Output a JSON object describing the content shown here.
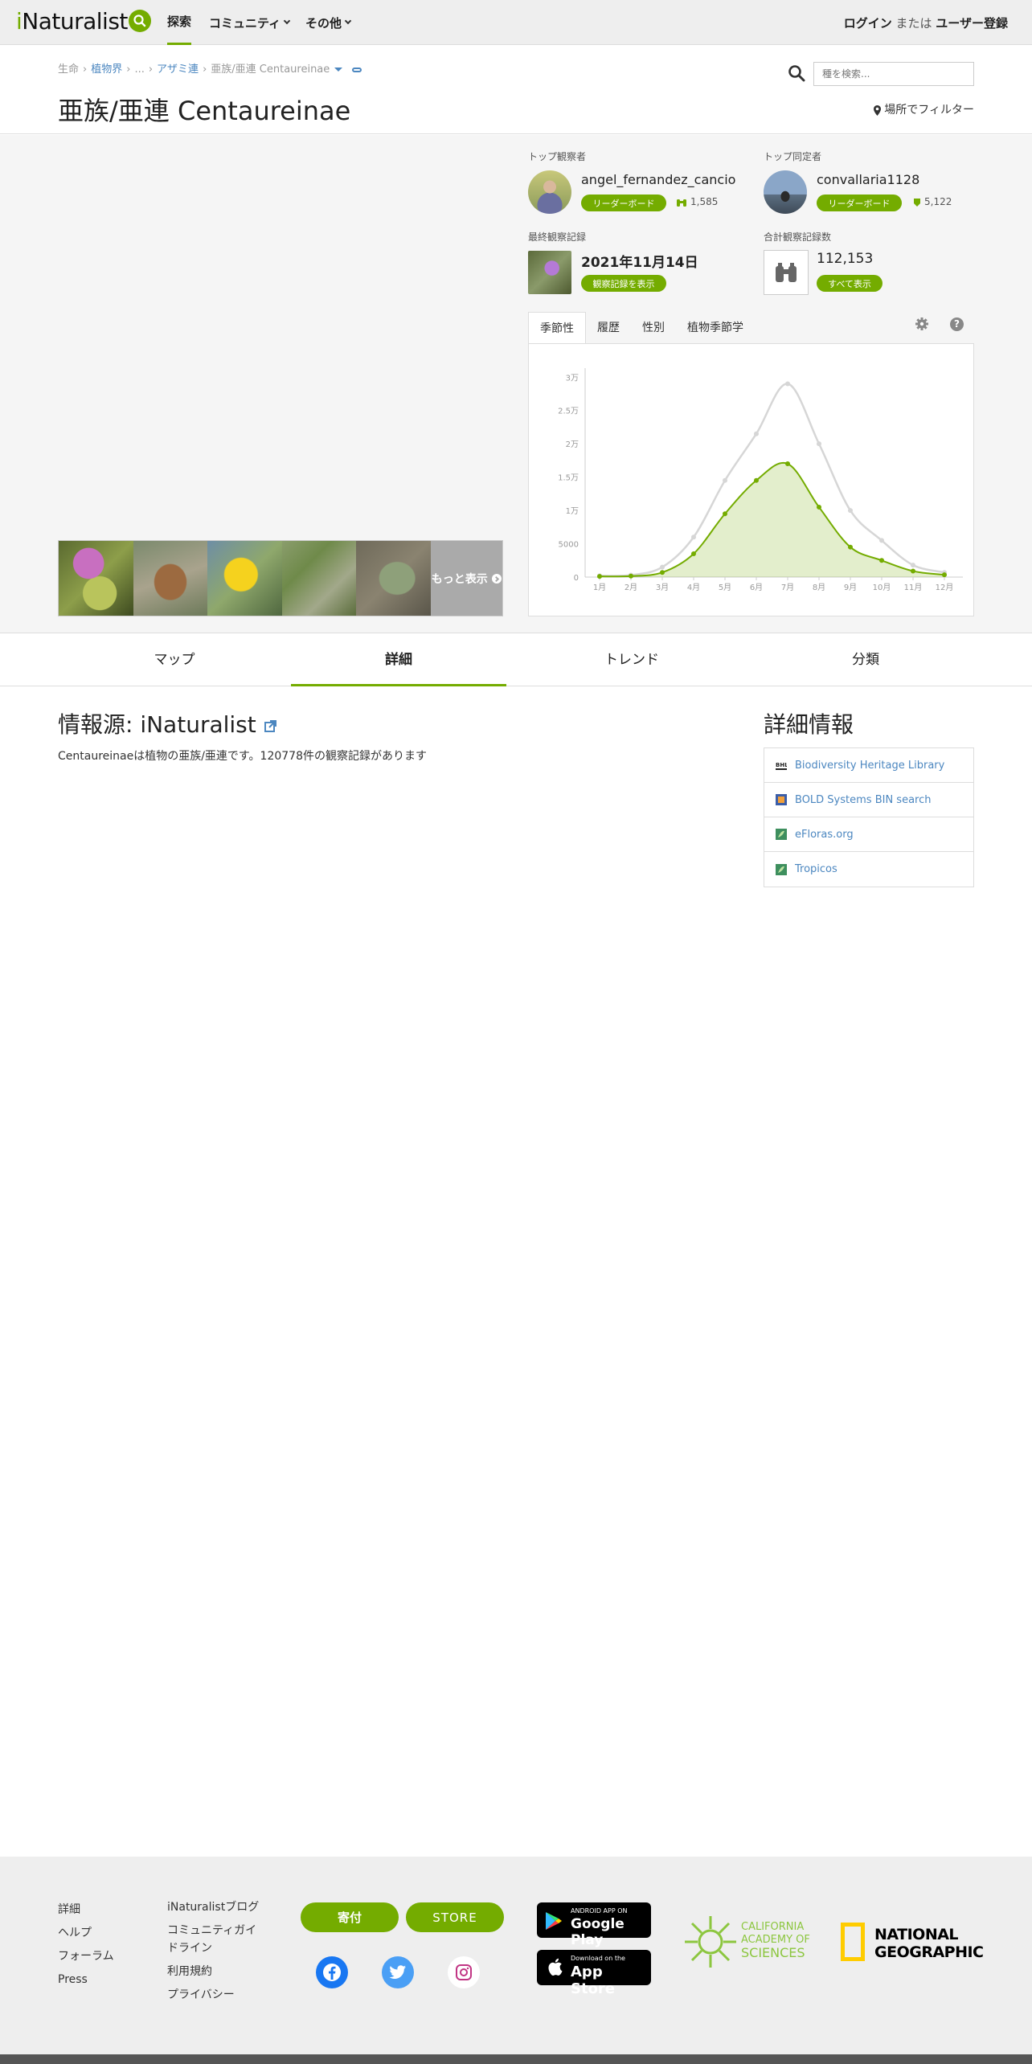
{
  "header": {
    "logo": "iNaturalist",
    "nav": [
      {
        "label": "探索"
      },
      {
        "label": "コミュニティ"
      },
      {
        "label": "その他"
      }
    ],
    "login": "ログイン",
    "or": "または",
    "signup": "ユーザー登録"
  },
  "breadcrumb": {
    "items": [
      "生命",
      "植物界",
      "...",
      "アザミ連"
    ],
    "current": "亜族/亜連 Centaureinae"
  },
  "title": {
    "rank": "亜族/亜連",
    "name": "Centaureinae"
  },
  "search": {
    "placeholder": "種を検索..."
  },
  "filter": "場所でフィルター",
  "photos": {
    "more": "もっと表示"
  },
  "stats": {
    "top_observer_label": "トップ観察者",
    "top_observer": "angel_fernandez_cancio",
    "top_observer_count": "1,585",
    "top_identifier_label": "トップ同定者",
    "top_identifier": "convallaria1128",
    "top_identifier_count": "5,122",
    "leaderboard": "リーダーボード",
    "last_obs_label": "最終観察記録",
    "last_obs_date": "2021年11月14日",
    "view_obs": "観察記録を表示",
    "total_obs_label": "合計観察記録数",
    "total_obs": "112,153",
    "view_all": "すべて表示"
  },
  "chart_tabs": [
    "季節性",
    "履歴",
    "性別",
    "植物季節学"
  ],
  "chart_data": {
    "type": "area",
    "categories": [
      "1月",
      "2月",
      "3月",
      "4月",
      "5月",
      "6月",
      "7月",
      "8月",
      "9月",
      "10月",
      "11月",
      "12月"
    ],
    "yticks": [
      "0",
      "5000",
      "1万",
      "1.5万",
      "2万",
      "2.5万",
      "3万"
    ],
    "ylim": [
      0,
      30000
    ],
    "grid": false,
    "series": [
      {
        "color": "#d6d6d6",
        "values": [
          200,
          300,
          1500,
          6000,
          14500,
          21500,
          29000,
          20000,
          10000,
          5500,
          1800,
          700
        ]
      },
      {
        "color": "#74ac00",
        "values": [
          100,
          150,
          700,
          3500,
          9500,
          14500,
          17000,
          10500,
          4500,
          2500,
          900,
          350
        ]
      }
    ]
  },
  "main_tabs": [
    "マップ",
    "詳細",
    "トレンド",
    "分類"
  ],
  "source": {
    "title": "情報源: iNaturalist",
    "description": "Centaureinaeは植物の亜族/亜連です。120778件の観察記録があります"
  },
  "more_info": {
    "title": "詳細情報",
    "links": [
      {
        "label": "Biodiversity Heritage Library"
      },
      {
        "label": "BOLD Systems BIN search"
      },
      {
        "label": "eFloras.org"
      },
      {
        "label": "Tropicos"
      }
    ]
  },
  "footer": {
    "col1": [
      "詳細",
      "ヘルプ",
      "フォーラム",
      "Press"
    ],
    "col2": [
      "iNaturalistブログ",
      "コミュニティガイドライン",
      "利用規約",
      "プライバシー"
    ],
    "donate": "寄付",
    "store": "STORE",
    "google_l1": "ANDROID APP ON",
    "google_l2": "Google Play",
    "apple_l1": "Download on the",
    "apple_l2": "App Store",
    "cas": [
      "CALIFORNIA",
      "ACADEMY OF",
      "SCIENCES"
    ],
    "natgeo": [
      "NATIONAL",
      "GEOGRAPHIC"
    ]
  }
}
